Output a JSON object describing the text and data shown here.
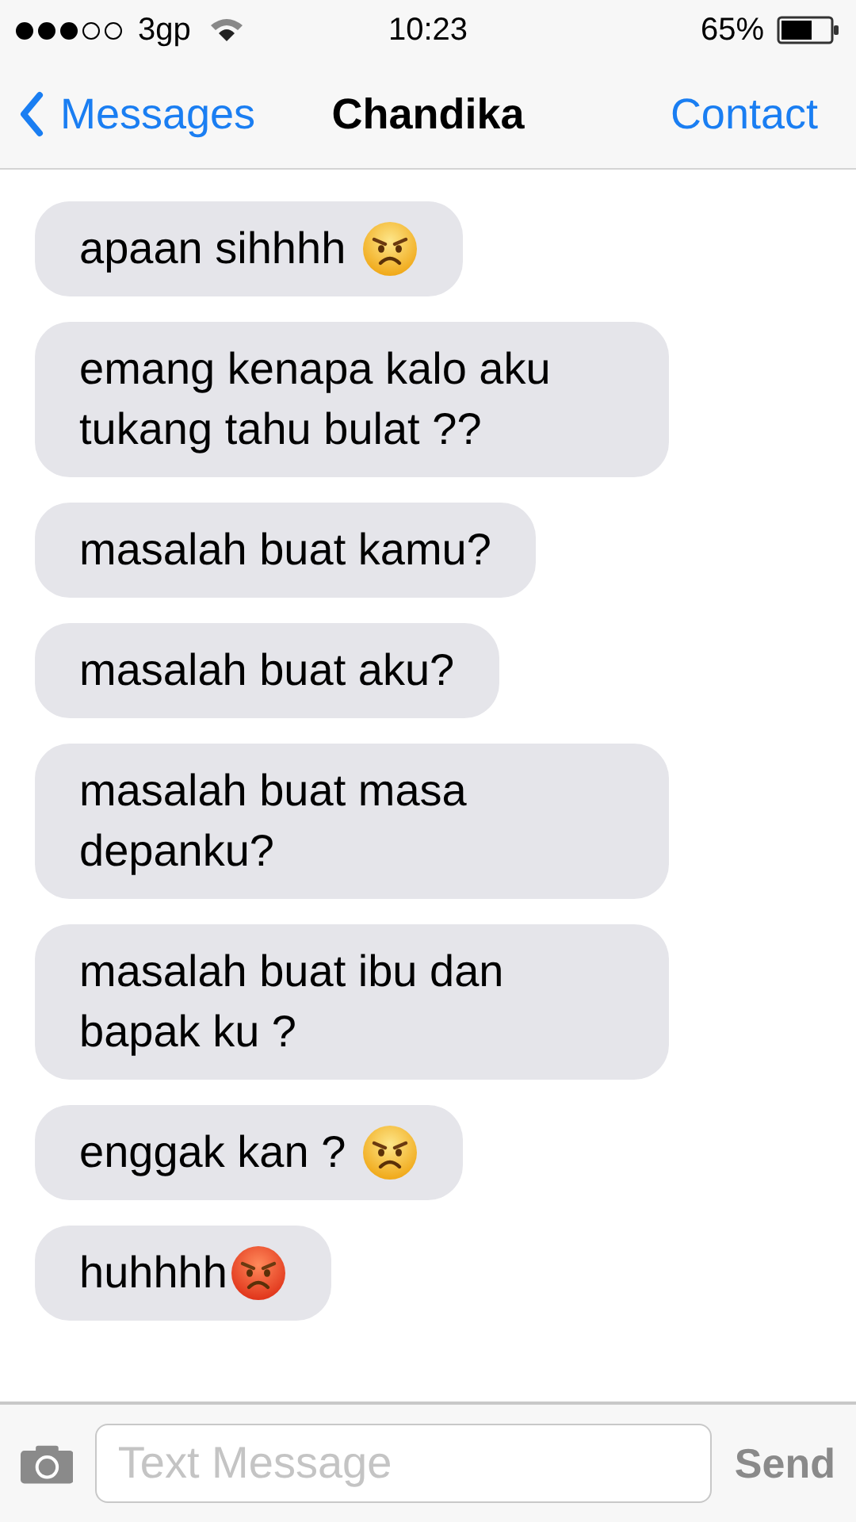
{
  "status_bar": {
    "carrier": "3gp",
    "time": "10:23",
    "battery": "65%"
  },
  "nav_bar": {
    "back": "Messages",
    "title": "Chandika",
    "action": "Contact"
  },
  "messages": [
    {
      "text": "apaan sihhhh ",
      "kind": "angry"
    },
    {
      "text": "emang kenapa kalo aku tukang tahu bulat ??"
    },
    {
      "text": "masalah buat kamu?"
    },
    {
      "text": "masalah buat aku?"
    },
    {
      "text": "masalah buat masa depanku?"
    },
    {
      "text": "masalah buat ibu dan bapak ku ?"
    },
    {
      "text": "enggak kan ? ",
      "kind": "angry"
    },
    {
      "text": "huhhhh",
      "kind": "pouting"
    }
  ],
  "composer": {
    "placeholder": "Text Message",
    "send": "Send"
  }
}
